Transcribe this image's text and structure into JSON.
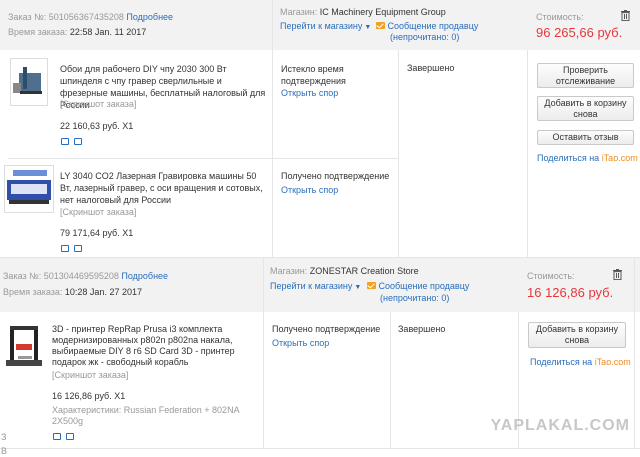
{
  "orders": [
    {
      "order_no_label": "Заказ №:",
      "order_no": "501056367435208",
      "details_link": "Подробнее",
      "time_label": "Время заказа:",
      "time": "22:58 Jan. 11 2017",
      "store_label": "Магазин:",
      "store_name": "IC Machinery Equipment Group",
      "store_link": "Перейти к магазину",
      "message_link": "Сообщение продавцу",
      "unread": "(непрочитано: 0)",
      "cost_label": "Стоимость:",
      "cost": "96 265,66 руб.",
      "items": [
        {
          "title": "Обои для рабочего DIY чпу 2030 300 Вт шпинделя с чпу гравер сверлильные и фрезерные машины, бесплатный налоговый для России",
          "screenshot": "[Скриншот заказа]",
          "price": "22 160,63 руб. X1",
          "status": "Истекло время подтверждения",
          "dispute": "Открыть спор",
          "state": "Завершено",
          "buttons": [
            "Проверить отслеживание",
            "Добавить в корзину снова",
            "Оставить отзыв"
          ],
          "share_text": "Поделиться на ",
          "share_site": "iTao.com"
        },
        {
          "title": "LY 3040 CO2 Лазерная Гравировка машины 50 Вт, лазерный гравер, с оси вращения и сотовых, нет налоговый для России",
          "screenshot": "[Скриншот заказа]",
          "price": "79 171,64 руб. X1",
          "status": "Получено подтверждение",
          "dispute": "Открыть спор"
        }
      ]
    },
    {
      "order_no_label": "Заказ №:",
      "order_no": "501304469595208",
      "details_link": "Подробнее",
      "time_label": "Время заказа:",
      "time": "10:28 Jan. 27 2017",
      "store_label": "Магазин:",
      "store_name": "ZONESTAR Creation Store",
      "store_link": "Перейти к магазину",
      "message_link": "Сообщение продавцу",
      "unread": "(непрочитано: 0)",
      "cost_label": "Стоимость:",
      "cost": "16 126,86 руб.",
      "items": [
        {
          "title": "3D - принтер RepRap Prusa i3 комплекта модернизированных p802n p802na накала, выбираемые DIY 8 г6 SD Card 3D - принтер подарок жк - свободный корабль",
          "screenshot": "[Скриншот заказа]",
          "price": "16 126,86 руб. X1",
          "specs_label": "Характеристики:",
          "specs": "Russian Federation + 802NA 2X500g",
          "status": "Получено подтверждение",
          "dispute": "Открыть спор",
          "state": "Завершено",
          "buttons": [
            "Добавить в корзину снова"
          ],
          "share_text": "Поделиться на ",
          "share_site": "iTao.com"
        }
      ]
    }
  ],
  "watermark": "YAPLAKAL.COM",
  "side_fragments": [
    "З",
    "В"
  ]
}
